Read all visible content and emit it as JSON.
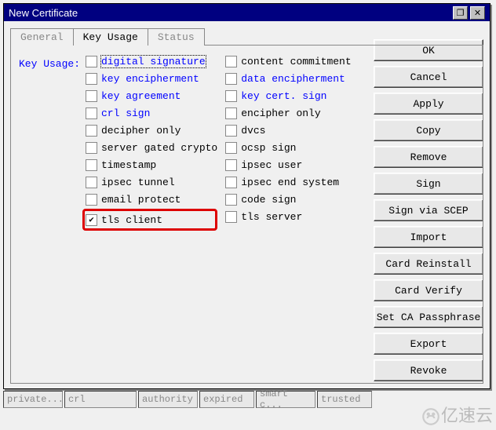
{
  "window": {
    "title": "New Certificate",
    "min_icon": "❐",
    "close_icon": "✕"
  },
  "tabs": {
    "general": "General",
    "key_usage": "Key Usage",
    "status": "Status"
  },
  "form": {
    "label": "Key Usage:",
    "left": [
      {
        "label": "digital signature",
        "link": true,
        "checked": false,
        "focus": true
      },
      {
        "label": "key encipherment",
        "link": true,
        "checked": false
      },
      {
        "label": "key agreement",
        "link": true,
        "checked": false
      },
      {
        "label": "crl sign",
        "link": true,
        "checked": false
      },
      {
        "label": "decipher only",
        "link": false,
        "checked": false
      },
      {
        "label": "server gated crypto",
        "link": false,
        "checked": false
      },
      {
        "label": "timestamp",
        "link": false,
        "checked": false
      },
      {
        "label": "ipsec tunnel",
        "link": false,
        "checked": false
      },
      {
        "label": "email protect",
        "link": false,
        "checked": false
      },
      {
        "label": "tls client",
        "link": false,
        "checked": true,
        "highlight": true
      }
    ],
    "right": [
      {
        "label": "content commitment",
        "link": false,
        "checked": false
      },
      {
        "label": "data encipherment",
        "link": true,
        "checked": false
      },
      {
        "label": "key cert. sign",
        "link": true,
        "checked": false
      },
      {
        "label": "encipher only",
        "link": false,
        "checked": false
      },
      {
        "label": "dvcs",
        "link": false,
        "checked": false
      },
      {
        "label": "ocsp sign",
        "link": false,
        "checked": false
      },
      {
        "label": "ipsec user",
        "link": false,
        "checked": false
      },
      {
        "label": "ipsec end system",
        "link": false,
        "checked": false
      },
      {
        "label": "code sign",
        "link": false,
        "checked": false
      },
      {
        "label": "tls server",
        "link": false,
        "checked": false
      }
    ]
  },
  "buttons": {
    "ok": "OK",
    "cancel": "Cancel",
    "apply": "Apply",
    "copy": "Copy",
    "remove": "Remove",
    "sign": "Sign",
    "sign_scep": "Sign via SCEP",
    "import": "Import",
    "card_reinstall": "Card Reinstall",
    "card_verify": "Card Verify",
    "set_ca_pass": "Set CA Passphrase",
    "export": "Export",
    "revoke": "Revoke"
  },
  "status": {
    "private": "private...",
    "crl": "crl",
    "authority": "authority",
    "expired": "expired",
    "smart": "smart c...",
    "trusted": "trusted"
  },
  "watermark": "亿速云"
}
